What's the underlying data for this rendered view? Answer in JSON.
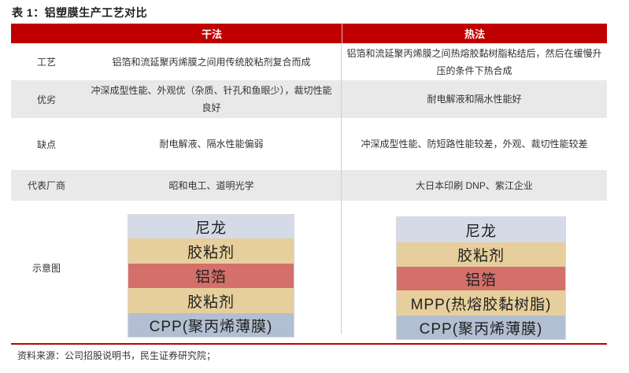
{
  "title": "表 1：铝塑膜生产工艺对比",
  "header": {
    "empty": "",
    "dry": "干法",
    "hot": "热法"
  },
  "rows": [
    {
      "label": "工艺",
      "dry": "铝箔和流延聚丙烯膜之间用传统胶粘剂复合而成",
      "hot": "铝箔和流延聚丙烯膜之间热熔胶黏树脂粘结后，然后在缓慢升压的条件下热合成"
    },
    {
      "label": "优劣",
      "dry": "冲深成型性能、外观优（杂质、针孔和鱼眼少），裁切性能良好",
      "hot": "耐电解液和隔水性能好"
    },
    {
      "label": "缺点",
      "dry": "耐电解液、隔水性能偏弱",
      "hot": "冲深成型性能、防短路性能较差，外观、裁切性能较差"
    },
    {
      "label": "代表厂商",
      "dry": "昭和电工、道明光学",
      "hot": "大日本印刷 DNP、紫江企业"
    },
    {
      "label": "示意图"
    }
  ],
  "diagram": {
    "dry_layers": [
      "尼龙",
      "胶粘剂",
      "铝箔",
      "胶粘剂",
      "CPP(聚丙烯薄膜)"
    ],
    "hot_layers": [
      "尼龙",
      "胶粘剂",
      "铝箔",
      "MPP(热熔胶黏树脂)",
      "CPP(聚丙烯薄膜)"
    ],
    "colors": {
      "nylon": "#d5dbe6",
      "adhesive": "#e6cf9c",
      "aluminum": "#d46f6a",
      "cpp": "#b2bfd2",
      "header": "#c00000"
    }
  },
  "source": "资料来源：公司招股说明书，民生证券研究院；"
}
